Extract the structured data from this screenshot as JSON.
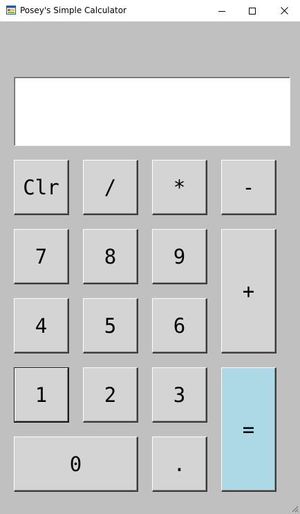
{
  "window": {
    "title": "Posey's Simple Calculator",
    "icon": "app-window-icon",
    "controls": {
      "minimize": "minimize-icon",
      "maximize": "maximize-icon",
      "close": "close-icon"
    }
  },
  "display": {
    "value": ""
  },
  "buttons": {
    "clear": "Clr",
    "divide": "/",
    "multiply": "*",
    "subtract": "-",
    "seven": "7",
    "eight": "8",
    "nine": "9",
    "add": "+",
    "four": "4",
    "five": "5",
    "six": "6",
    "one": "1",
    "two": "2",
    "three": "3",
    "equals": "=",
    "zero": "0",
    "decimal": "."
  },
  "colors": {
    "background": "#c0c0c0",
    "button_face": "#d4d4d4",
    "equals_button": "#add8e6",
    "display_background": "#ffffff"
  }
}
